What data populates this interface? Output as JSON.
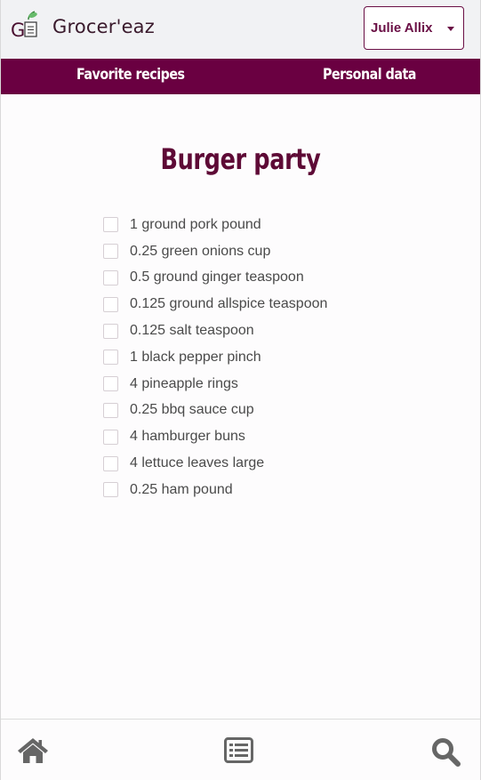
{
  "app": {
    "name": "Grocer'eaz"
  },
  "user": {
    "name": "Julie Allix"
  },
  "nav": {
    "favorite_recipes": "Favorite recipes",
    "personal_data": "Personal data"
  },
  "recipe": {
    "title": "Burger party",
    "ingredients": [
      "1 ground pork pound",
      "0.25 green onions cup",
      "0.5 ground ginger teaspoon",
      "0.125 ground allspice teaspoon",
      "0.125 salt teaspoon",
      "1 black pepper pinch",
      "4 pineapple rings",
      "0.25 bbq sauce cup",
      "4 hamburger buns",
      "4 lettuce leaves large",
      "0.25 ham pound"
    ]
  },
  "bottom_nav": {
    "icons": [
      "home-icon",
      "list-icon",
      "search-icon"
    ]
  },
  "colors": {
    "brand": "#6a0041",
    "title": "#5e0a36",
    "icon": "#666666"
  }
}
